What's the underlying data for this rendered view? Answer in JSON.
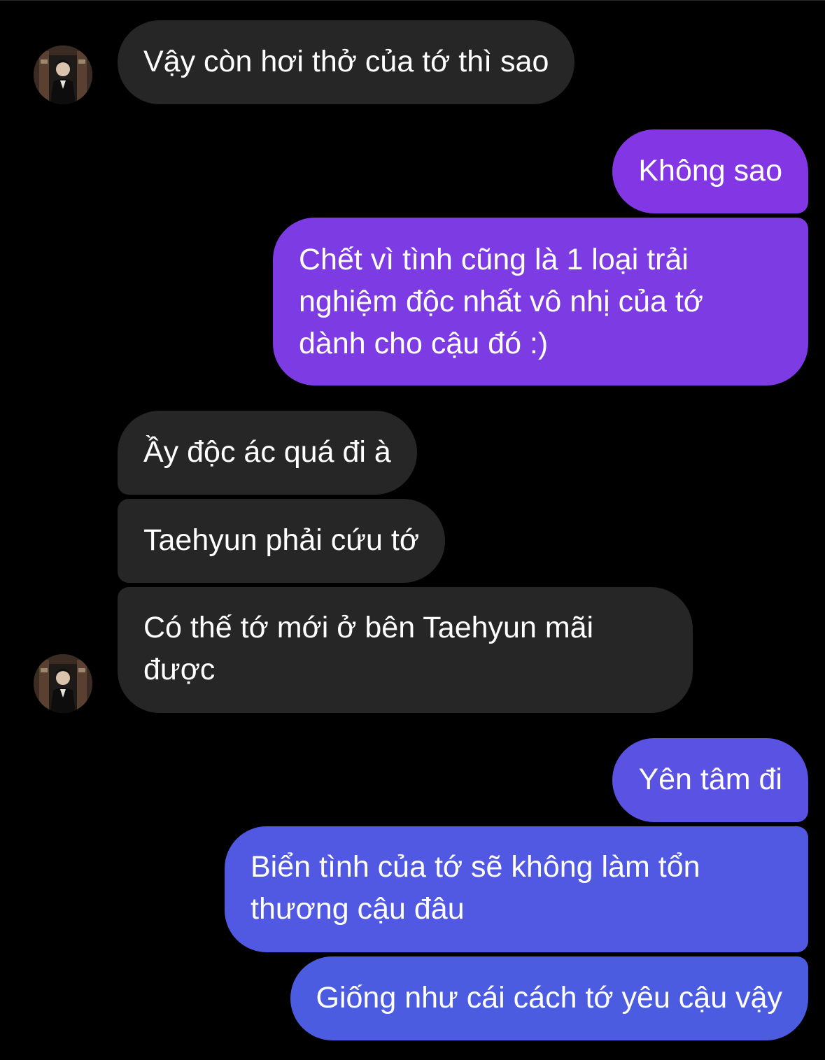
{
  "colors": {
    "background": "#000000",
    "incoming_bubble": "#262626",
    "outgoing_top": "#8336E4",
    "outgoing_bottom": "#4B5CE0",
    "text": "#FFFFFF"
  },
  "contact": {
    "avatar_icon": "contact-avatar-photo"
  },
  "messages": [
    {
      "id": "m1",
      "sender": "contact",
      "text": "Vậy còn hơi thở của tớ thì sao"
    },
    {
      "id": "m2",
      "sender": "me",
      "text": "Không sao"
    },
    {
      "id": "m3",
      "sender": "me",
      "lines": [
        "Chết vì tình cũng là 1 loại trải",
        "nghiệm độc nhất vô nhị của tớ",
        "dành cho cậu đó :)"
      ]
    },
    {
      "id": "m4",
      "sender": "contact",
      "text": "Ầy độc ác quá đi à"
    },
    {
      "id": "m5",
      "sender": "contact",
      "text": "Taehyun phải cứu tớ"
    },
    {
      "id": "m6",
      "sender": "contact",
      "lines": [
        "Có thế tớ mới ở bên Taehyun mãi",
        "được"
      ]
    },
    {
      "id": "m7",
      "sender": "me",
      "text": "Yên tâm đi"
    },
    {
      "id": "m8",
      "sender": "me",
      "lines": [
        "Biển tình của tớ sẽ không làm tổn",
        "thương cậu đâu"
      ]
    },
    {
      "id": "m9",
      "sender": "me",
      "text": "Giống như cái cách tớ yêu cậu vậy"
    }
  ]
}
